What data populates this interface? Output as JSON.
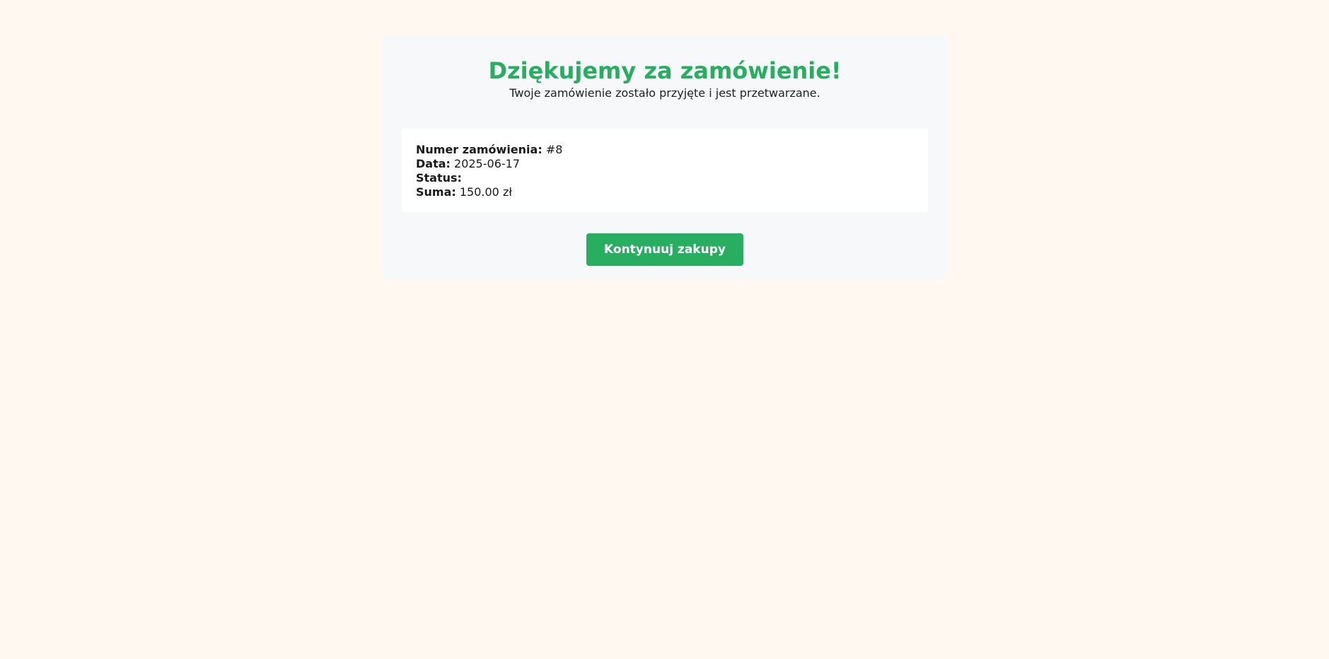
{
  "thank_you": {
    "title": "Dziękujemy za zamówienie!",
    "subtitle": "Twoje zamówienie zostało przyjęte i jest przetwarzane."
  },
  "order": {
    "number_label": "Numer zamówienia:",
    "number_value": "#8",
    "date_label": "Data:",
    "date_value": "2025-06-17",
    "status_label": "Status:",
    "status_value": "",
    "total_label": "Suma:",
    "total_value": "150.00 zł"
  },
  "actions": {
    "continue_label": "Kontynuuj zakupy"
  },
  "colors": {
    "accent": "#27ae60",
    "background": "#fff8f1",
    "card": "#f7f8fa"
  }
}
